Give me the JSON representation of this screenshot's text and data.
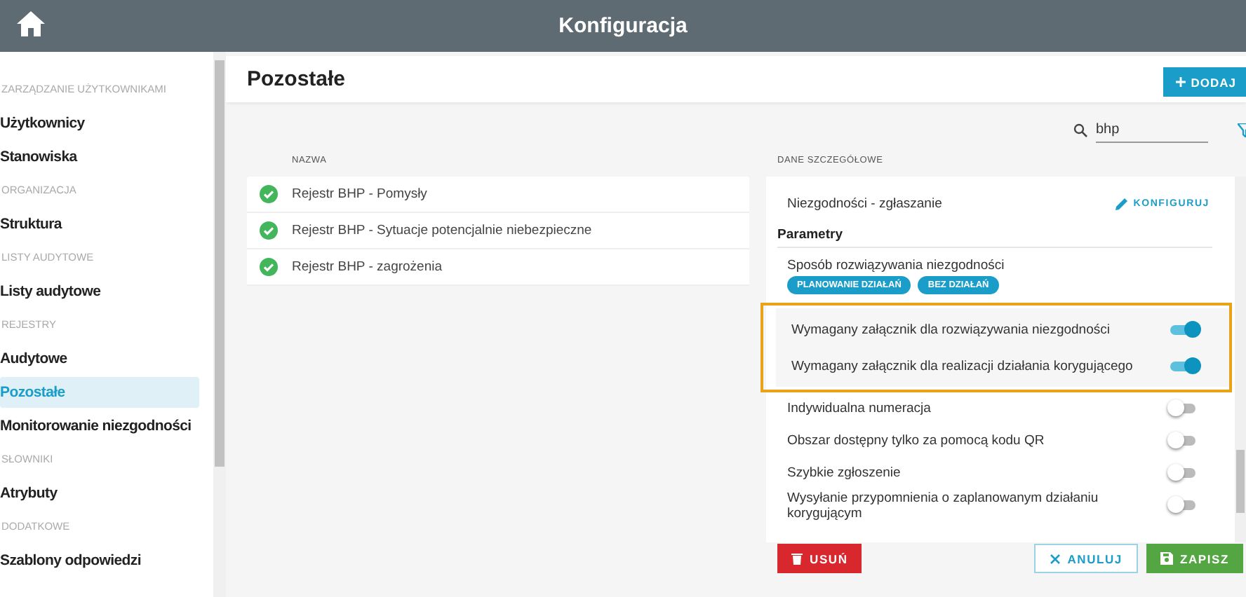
{
  "header": {
    "title": "Konfiguracja"
  },
  "sidebar": {
    "sections": [
      {
        "label": "ZARZĄDZANIE UŻYTKOWNIKAMI",
        "items": [
          {
            "label": "Użytkownicy",
            "selected": false
          },
          {
            "label": "Stanowiska",
            "selected": false
          }
        ]
      },
      {
        "label": "ORGANIZACJA",
        "items": [
          {
            "label": "Struktura",
            "selected": false
          }
        ]
      },
      {
        "label": "LISTY AUDYTOWE",
        "items": [
          {
            "label": "Listy audytowe",
            "selected": false
          }
        ]
      },
      {
        "label": "REJESTRY",
        "items": [
          {
            "label": "Audytowe",
            "selected": false
          },
          {
            "label": "Pozostałe",
            "selected": true
          },
          {
            "label": "Monitorowanie niezgodności",
            "selected": false
          }
        ]
      },
      {
        "label": "SŁOWNIKI",
        "items": [
          {
            "label": "Atrybuty",
            "selected": false
          }
        ]
      },
      {
        "label": "DODATKOWE",
        "items": [
          {
            "label": "Szablony odpowiedzi",
            "selected": false
          }
        ]
      }
    ]
  },
  "page": {
    "title": "Pozostałe",
    "add_button": "DODAJ",
    "search": {
      "value": "bhp"
    }
  },
  "list": {
    "column": "NAZWA",
    "rows": [
      {
        "name": "Rejestr BHP - Pomysły",
        "active": true
      },
      {
        "name": "Rejestr BHP - Sytuacje potencjalnie niebezpieczne",
        "active": true
      },
      {
        "name": "Rejestr BHP - zagrożenia",
        "active": true
      }
    ]
  },
  "details": {
    "heading": "DANE SZCZEGÓŁOWE",
    "config_rows": [
      {
        "label": "Niezgodności - zgłaszanie",
        "action": "KONFIGURUJ"
      }
    ],
    "params_title": "Parametry",
    "resolution": {
      "label": "Sposób rozwiązywania niezgodności",
      "chips": [
        "PLANOWANIE DZIAŁAŃ",
        "BEZ DZIAŁAŃ"
      ]
    },
    "switches": [
      {
        "label": "Wymagany załącznik dla rozwiązywania niezgodności",
        "on": true,
        "highlighted": true
      },
      {
        "label": "Wymagany załącznik dla realizacji działania korygującego",
        "on": true,
        "highlighted": true
      },
      {
        "label": "Indywidualna numeracja",
        "on": false,
        "highlighted": false
      },
      {
        "label": "Obszar dostępny tylko za pomocą kodu QR",
        "on": false,
        "highlighted": false
      },
      {
        "label": "Szybkie zgłoszenie",
        "on": false,
        "highlighted": false
      },
      {
        "label": "Wysyłanie przypomnienia o zaplanowanym działaniu korygującym",
        "on": false,
        "highlighted": false
      }
    ],
    "buttons": [
      {
        "kind": "delete",
        "label": "USUŃ"
      },
      {
        "kind": "cancel",
        "label": "ANULUJ"
      },
      {
        "kind": "save",
        "label": "ZAPISZ"
      }
    ]
  }
}
